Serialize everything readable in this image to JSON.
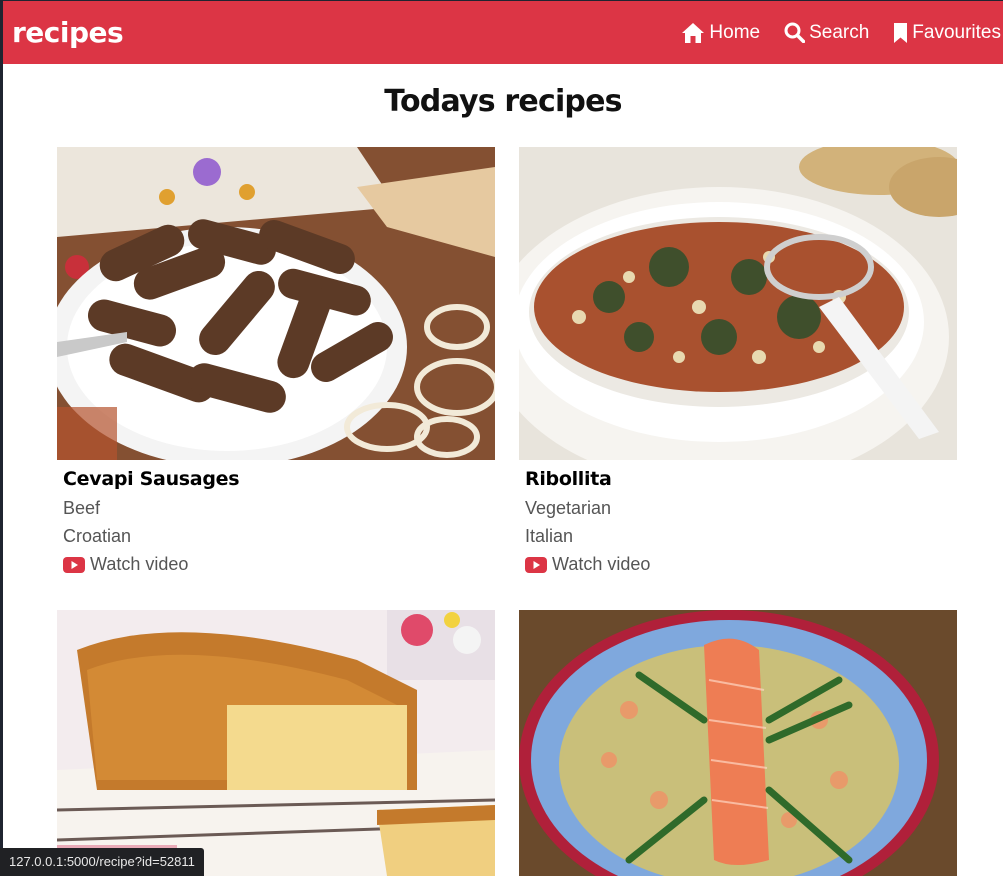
{
  "navbar": {
    "brand": "recipes",
    "links": [
      {
        "label": "Home",
        "icon": "home-icon"
      },
      {
        "label": "Search",
        "icon": "search-icon"
      },
      {
        "label": "Favourites",
        "icon": "bookmark-icon"
      }
    ]
  },
  "page_title": "Todays recipes",
  "recipes": [
    {
      "name": "Cevapi Sausages",
      "category": "Beef",
      "area": "Croatian",
      "video_label": "Watch video"
    },
    {
      "name": "Ribollita",
      "category": "Vegetarian",
      "area": "Italian",
      "video_label": "Watch video"
    },
    {
      "name": "",
      "category": "",
      "area": "",
      "video_label": ""
    },
    {
      "name": "",
      "category": "",
      "area": "",
      "video_label": ""
    }
  ],
  "status_bar": {
    "url": "127.0.0.1:5000/recipe?id=52811"
  },
  "colors": {
    "brand_red": "#dc3545",
    "youtube_red": "#dc3545"
  }
}
